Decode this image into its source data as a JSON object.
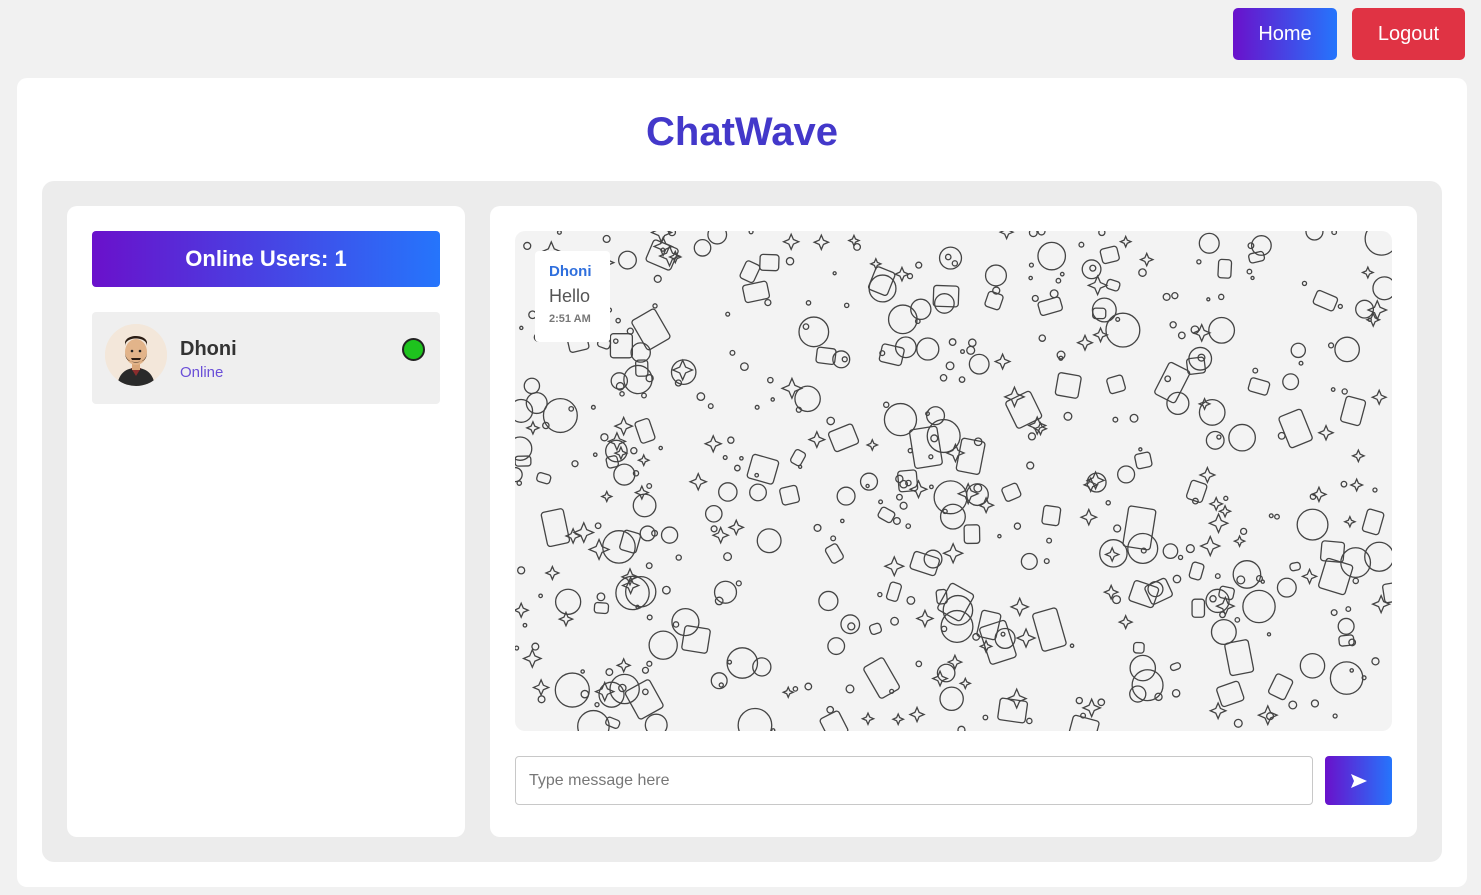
{
  "nav": {
    "home_label": "Home",
    "logout_label": "Logout"
  },
  "app": {
    "title": "ChatWave"
  },
  "sidebar": {
    "header": "Online Users: 1",
    "users": [
      {
        "name": "Dhoni",
        "status": "Online",
        "status_color": "#1ec31e"
      }
    ]
  },
  "chat": {
    "messages": [
      {
        "sender": "Dhoni",
        "text": "Hello",
        "time": "2:51 AM"
      }
    ],
    "input": {
      "placeholder": "Type message here",
      "value": ""
    },
    "send_icon": "send-arrow-icon"
  },
  "colors": {
    "accent_start": "#6a11cb",
    "accent_end": "#2575fc",
    "logout": "#e03344",
    "title": "#4338ca"
  }
}
